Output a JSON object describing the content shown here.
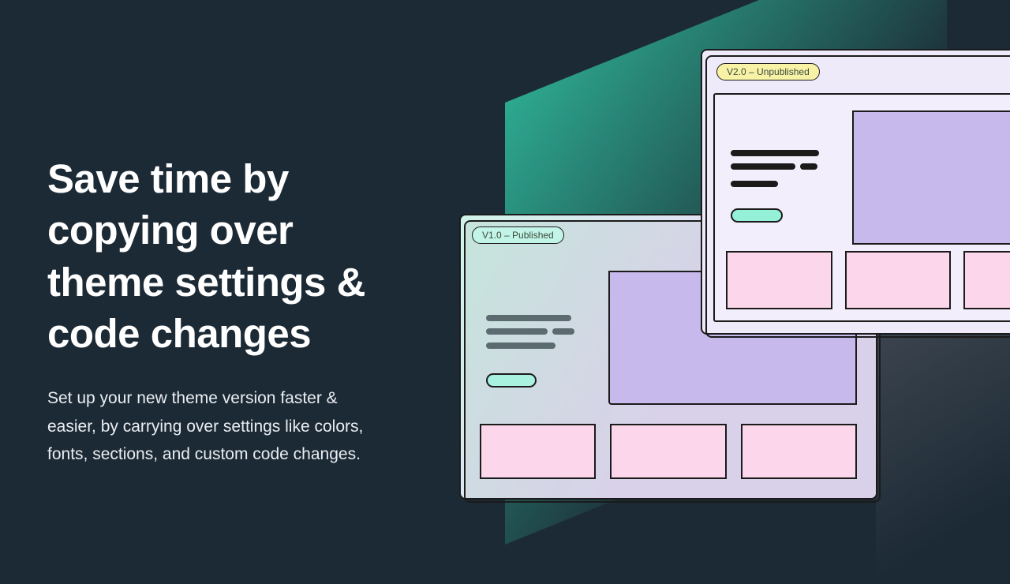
{
  "hero": {
    "headline": "Save time by copying over theme settings & code changes",
    "subtext": "Set up your new theme version faster & easier, by carrying over settings like colors, fonts, sections, and custom code changes."
  },
  "windows": {
    "back": {
      "badge": "V1.0 – Published"
    },
    "front": {
      "badge": "V2.0 – Unpublished"
    }
  }
}
